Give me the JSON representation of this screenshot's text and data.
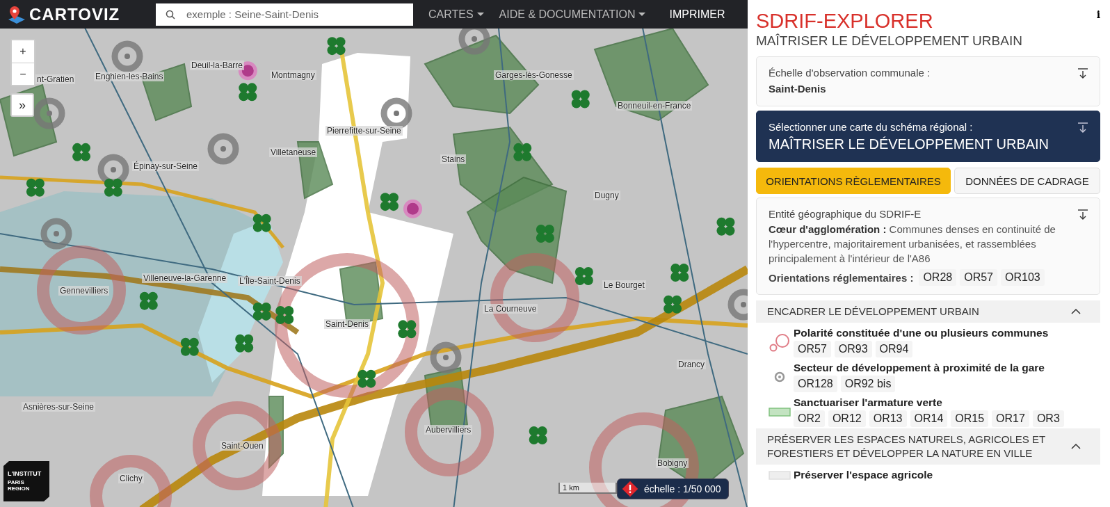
{
  "navbar": {
    "logo_text": "CARTOVIZ",
    "search": {
      "placeholder": "exemple : Seine-Saint-Denis"
    },
    "menus": [
      {
        "label": "CARTES",
        "kind": "dropdown"
      },
      {
        "label": "AIDE & DOCUMENTATION",
        "kind": "dropdown"
      },
      {
        "label": "IMPRIMER",
        "kind": "link"
      }
    ]
  },
  "map": {
    "controls": [
      {
        "kind": "zoom-in",
        "label": "+"
      },
      {
        "kind": "zoom-out",
        "label": "−"
      },
      {
        "kind": "expand",
        "label": "»"
      }
    ],
    "labels": [
      "nt-Gratien",
      "Enghien-les-Bains",
      "Deuil-la-Barre",
      "Montmagny",
      "Garges-lès-Gonesse",
      "Bonneuil-en-France",
      "Pierrefitte-sur-Seine",
      "Villetaneuse",
      "Stains",
      "Épinay-sur-Seine",
      "Dugny",
      "Villeneuve-la-Garenne",
      "L'Île-Saint-Denis",
      "Gennevilliers",
      "Le Bourget",
      "La Courneuve",
      "Saint-Denis",
      "Drancy",
      "Asnières-sur-Seine",
      "Aubervilliers",
      "Saint-Ouen",
      "Bobigny",
      "Clichy"
    ],
    "logo_lines": [
      "L'INSTITUT",
      "PARIS",
      "REGION"
    ],
    "scale_bar": "1 km",
    "scale": "échelle : 1/50 000"
  },
  "panel": {
    "title": "SDRIF-EXPLORER",
    "subtitle": "MAÎTRISER LE DÉVELOPPEMENT URBAIN",
    "info": "i",
    "scale_card": {
      "label": "Échelle d'observation communale :",
      "value": "Saint-Denis"
    },
    "map_select": {
      "label": "Sélectionner une carte du schéma régional :",
      "value": "MAÎTRISER LE DÉVELOPPEMENT URBAIN"
    },
    "tabs": [
      {
        "label": "ORIENTATIONS RÈGLEMENTAIRES",
        "selected": true
      },
      {
        "label": "DONNÉES DE CADRAGE",
        "selected": false
      }
    ],
    "entity": {
      "heading": "Entité géographique du SDRIF-E",
      "description": "**Cœur d'agglomération :** Communes denses en continuité de l'hypercentre, majoritairement urbanisées, et rassemblées principalement à l'intérieur de l'A86",
      "orientations_label": "Orientations réglementaires :",
      "codes": [
        "OR28",
        "OR57",
        "OR103"
      ]
    },
    "sections": [
      {
        "title": "ENCADRER LE DÉVELOPPEMENT URBAIN",
        "expanded": true,
        "items": [
          {
            "kind": "polarity",
            "label": "Polarité constituée d'une ou plusieurs communes",
            "codes": [
              "OR57",
              "OR93",
              "OR94"
            ]
          },
          {
            "kind": "station",
            "label": "Secteur de développement à proximité de la gare",
            "codes": [
              "OR128",
              "OR92 bis"
            ]
          },
          {
            "kind": "green",
            "label": "Sanctuariser l'armature verte",
            "codes": [
              "OR2",
              "OR12",
              "OR13",
              "OR14",
              "OR15",
              "OR17",
              "OR3"
            ]
          }
        ]
      },
      {
        "title": "PRÉSERVER LES ESPACES NATURELS, AGRICOLES ET FORESTIERS ET DÉVELOPPER LA NATURE EN VILLE",
        "expanded": true,
        "items": [
          {
            "kind": "agri",
            "label": "Préserver l'espace agricole"
          }
        ]
      }
    ]
  }
}
